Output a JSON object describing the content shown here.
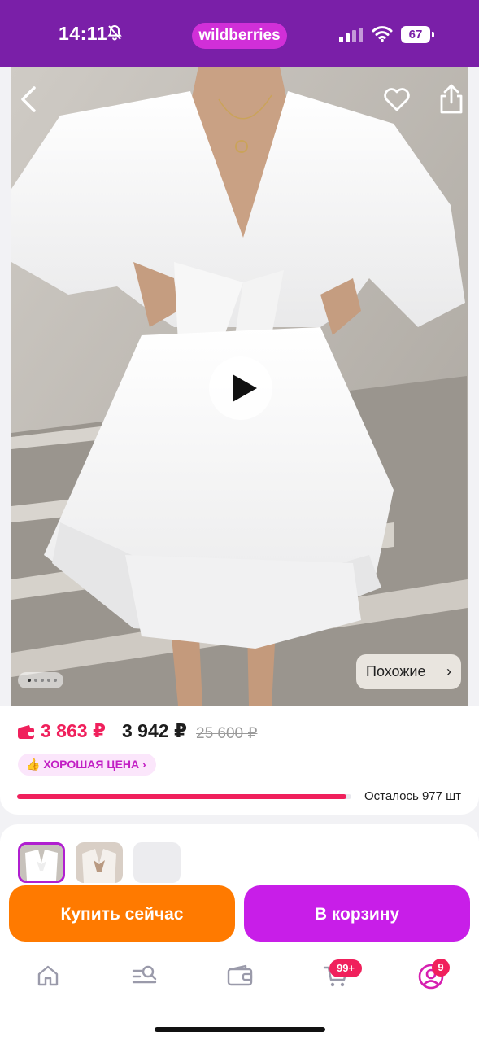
{
  "status_bar": {
    "time": "14:11",
    "brand": "wildberries",
    "battery": "67"
  },
  "photo": {
    "description_icon": "play-icon",
    "page_count": 5,
    "active_page": 0
  },
  "similar": {
    "label": "Похожие",
    "chevron": "›"
  },
  "price": {
    "wallet_price": "3 863 ₽",
    "price": "3 942 ₽",
    "old_price": "25 600 ₽",
    "badge": "👍 ХОРОШАЯ ЦЕНА ›",
    "stock_label": "Осталось 977 шт",
    "stock_fill_fraction": 0.985,
    "wallet_color": "#f0205c"
  },
  "actions": {
    "buy_now": "Купить сейчас",
    "add_to_cart": "В корзину"
  },
  "tabbar": {
    "items": [
      "home",
      "catalog-search",
      "wallet",
      "cart",
      "profile"
    ],
    "cart_count": "99+",
    "profile_count": "9"
  },
  "colors": {
    "brand": "#7a1fa8",
    "accent": "#c81ee8",
    "buy": "#ff7a00",
    "price": "#f0205c"
  }
}
